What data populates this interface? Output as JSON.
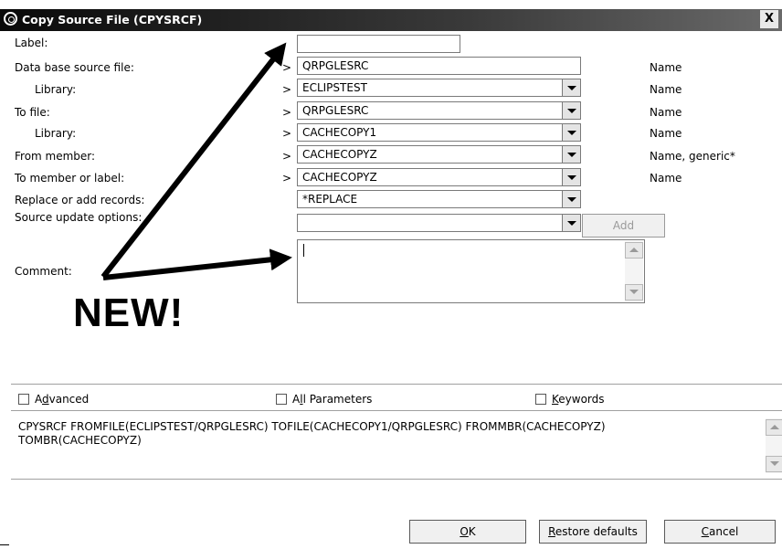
{
  "window": {
    "title": "Copy Source File (CPYSRCF)",
    "close_label": "X"
  },
  "fields": [
    {
      "label": "Label:",
      "value": ""
    },
    {
      "label": "Data base source file:",
      "value": "QRPGLESRC",
      "hint": "Name"
    },
    {
      "label": "Library:",
      "value": "ECLIPSTEST",
      "hint": "Name"
    },
    {
      "label": "To file:",
      "value": "QRPGLESRC",
      "hint": "Name"
    },
    {
      "label": "Library:",
      "value": "CACHECOPY1",
      "hint": "Name"
    },
    {
      "label": "From member:",
      "value": "CACHECOPYZ",
      "hint": "Name, generic*"
    },
    {
      "label": "To member or label:",
      "value": "CACHECOPYZ",
      "hint": "Name"
    },
    {
      "label": "Replace or add records:",
      "value": "*REPLACE"
    },
    {
      "label": "Source update options:",
      "value": ""
    }
  ],
  "prompt_marker": ">",
  "add_button": "Add",
  "comment": {
    "label": "Comment:",
    "value": ""
  },
  "annotation": "NEW!",
  "checkboxes": {
    "advanced": {
      "pre": "A",
      "u": "d",
      "post": "vanced"
    },
    "all_parameters": {
      "pre": "A",
      "u": "l",
      "post": "l Parameters"
    },
    "keywords": {
      "pre": "",
      "u": "K",
      "post": "eywords"
    }
  },
  "command_line_1": "CPYSRCF FROMFILE(ECLIPSTEST/QRPGLESRC) TOFILE(CACHECOPY1/QRPGLESRC) FROMMBR(CACHECOPYZ)",
  "command_line_2": "TOMBR(CACHECOPYZ)",
  "buttons": {
    "ok": {
      "u": "O",
      "post": "K"
    },
    "restore": {
      "u": "R",
      "post": "estore defaults"
    },
    "cancel": {
      "u": "C",
      "post": "ancel"
    }
  }
}
